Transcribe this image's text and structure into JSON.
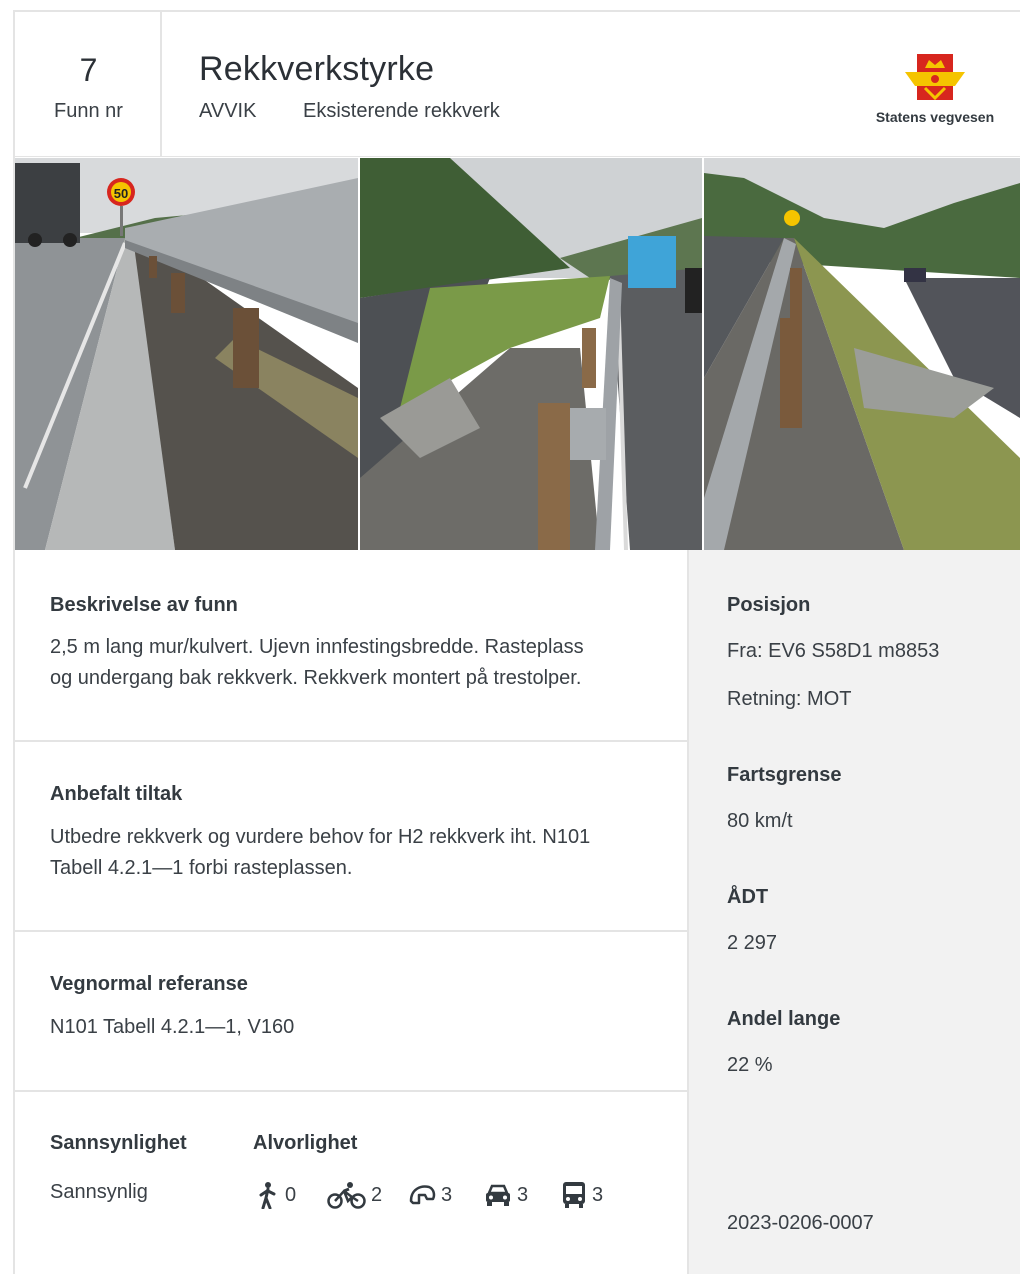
{
  "header": {
    "funn_number": "7",
    "funn_label": "Funn nr",
    "title": "Rekkverkstyrke",
    "type": "AVVIK",
    "category": "Eksisterende rekkverk",
    "logo_text": "Statens vegvesen"
  },
  "photos": {
    "sign_speed": "50"
  },
  "description": {
    "heading": "Beskrivelse av funn",
    "line1": "2,5 m lang mur/kulvert. Ujevn innfestingsbredde. Rasteplass",
    "line2": "og undergang bak rekkverk. Rekkverk montert på trestolper."
  },
  "recommendation": {
    "heading": "Anbefalt tiltak",
    "line1": "Utbedre rekkverk og vurdere behov for H2 rekkverk iht. N101",
    "line2": "Tabell 4.2.1—1 forbi rasteplassen."
  },
  "reference": {
    "heading": "Vegnormal referanse",
    "text": "N101 Tabell 4.2.1—1, V160"
  },
  "probability": {
    "heading": "Sannsynlighet",
    "value": "Sannsynlig"
  },
  "severity": {
    "heading": "Alvorlighet",
    "items": [
      {
        "icon": "pedestrian-icon",
        "value": "0"
      },
      {
        "icon": "bicycle-icon",
        "value": "2"
      },
      {
        "icon": "motorcycle-helmet-icon",
        "value": "3"
      },
      {
        "icon": "car-icon",
        "value": "3"
      },
      {
        "icon": "bus-icon",
        "value": "3"
      }
    ]
  },
  "position": {
    "heading": "Posisjon",
    "from": "Fra: EV6 S58D1 m8853",
    "direction": "Retning: MOT"
  },
  "speed": {
    "heading": "Fartsgrense",
    "value": "80 km/t"
  },
  "adt": {
    "heading": "ÅDT",
    "value": "2 297"
  },
  "long_share": {
    "heading": "Andel lange",
    "value": "22 %"
  },
  "case_id": "2023-0206-0007",
  "colors": {
    "logo_red": "#d7261e",
    "logo_yellow": "#f5c400",
    "panel_gray": "#f2f2f2",
    "border_gray": "#e4e4e4"
  }
}
